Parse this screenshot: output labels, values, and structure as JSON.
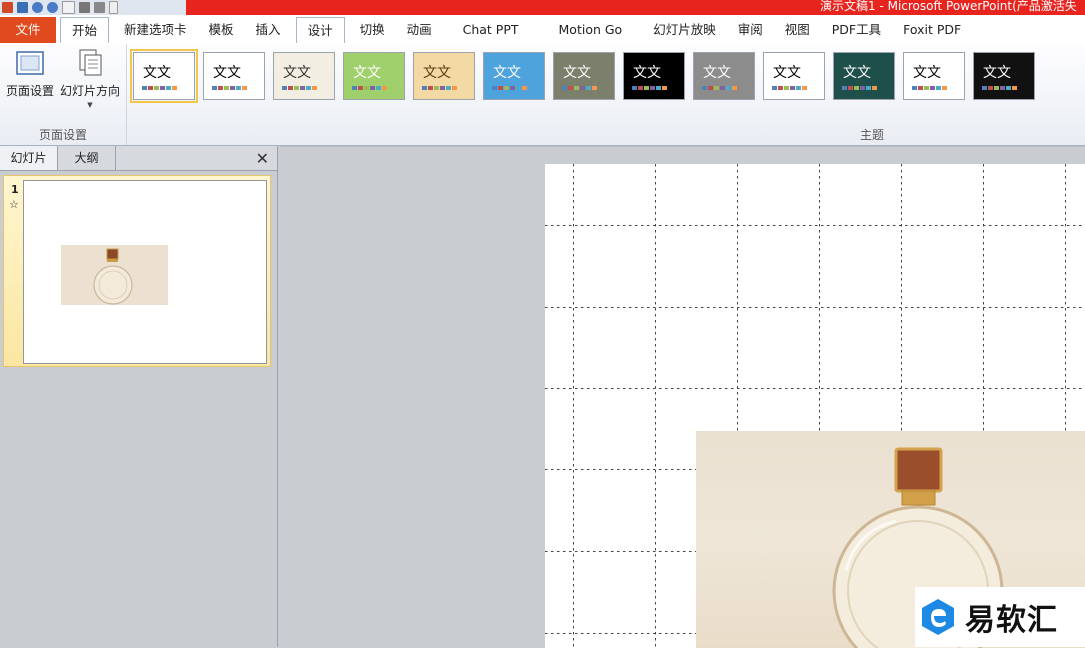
{
  "window": {
    "title": "演示文稿1 - Microsoft PowerPoint(产品激活失"
  },
  "tabs": [
    {
      "label": "文件"
    },
    {
      "label": "开始"
    },
    {
      "label": "新建选项卡"
    },
    {
      "label": "模板"
    },
    {
      "label": "插入"
    },
    {
      "label": "设计"
    },
    {
      "label": "切换"
    },
    {
      "label": "动画"
    },
    {
      "label": "Chat PPT"
    },
    {
      "label": "Motion Go"
    },
    {
      "label": "幻灯片放映"
    },
    {
      "label": "审阅"
    },
    {
      "label": "视图"
    },
    {
      "label": "PDF工具"
    },
    {
      "label": "Foxit PDF"
    }
  ],
  "active_tab": "设计",
  "ribbon": {
    "page_setup_group": {
      "label": "页面设置",
      "page_setup_button": "页面设置",
      "orientation_button": "幻灯片方向"
    },
    "themes_group": {
      "label": "主题",
      "thumb_text": "文文",
      "themes": [
        {
          "bg": "#ffffff",
          "text": "#000000"
        },
        {
          "bg": "#ffffff",
          "text": "#000000"
        },
        {
          "bg": "#f2efe2",
          "text": "#333333"
        },
        {
          "bg": "#9fd06b",
          "text": "#ffffff"
        },
        {
          "bg": "#f3d9a4",
          "text": "#5a3b10"
        },
        {
          "bg": "#4fa3dc",
          "text": "#ffffff"
        },
        {
          "bg": "#7c7f6c",
          "text": "#ffffff"
        },
        {
          "bg": "#000000",
          "text": "#ffffff"
        },
        {
          "bg": "#8c8c8c",
          "text": "#ffffff"
        },
        {
          "bg": "#ffffff",
          "text": "#000000"
        },
        {
          "bg": "#1f4f4a",
          "text": "#ffffff"
        },
        {
          "bg": "#ffffff",
          "text": "#000000"
        },
        {
          "bg": "#111111",
          "text": "#ffffff"
        }
      ]
    }
  },
  "panel": {
    "tab_slides": "幻灯片",
    "tab_outline": "大纲",
    "close": "✕",
    "slide_number": "1",
    "star": "☆"
  },
  "watermark": {
    "text": "易软汇"
  }
}
